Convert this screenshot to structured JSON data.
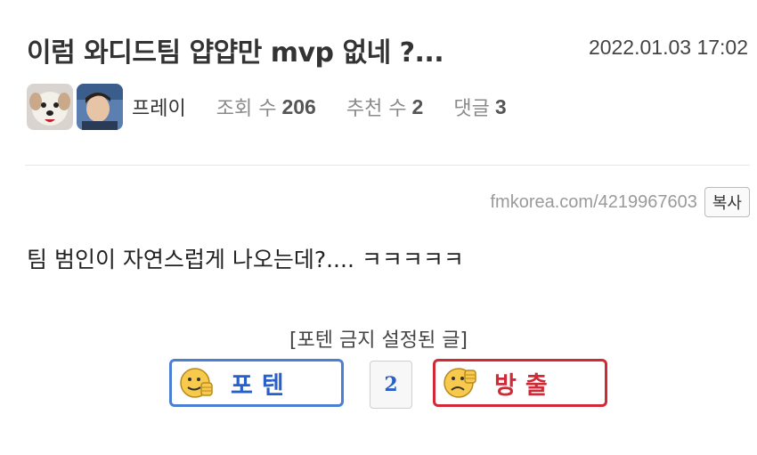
{
  "post": {
    "title": "이럼 와디드팀 얍얍만 mvp 없네 ?...",
    "date": "2022.01.03 17:02",
    "author": "프레이",
    "views_label": "조회 수",
    "views": "206",
    "recommend_label": "추천 수",
    "recommend": "2",
    "comments_label": "댓글",
    "comments": "3",
    "url": "fmkorea.com/4219967603",
    "copy_label": "복사",
    "body": "팀 범인이 자연스럽게 나오는데?.... ㅋㅋㅋㅋㅋ"
  },
  "vote": {
    "notice": "[포텐 금지 설정된 글]",
    "up_label": "포텐",
    "count": "2",
    "down_label": "방출"
  },
  "colors": {
    "up": "#4a7fd4",
    "down": "#cf2a36"
  },
  "icons": {
    "avatar1": "dog-face-avatar",
    "avatar2": "person-photo-avatar",
    "up": "thumbs-up-emoji-icon",
    "down": "thumbs-down-emoji-icon"
  }
}
